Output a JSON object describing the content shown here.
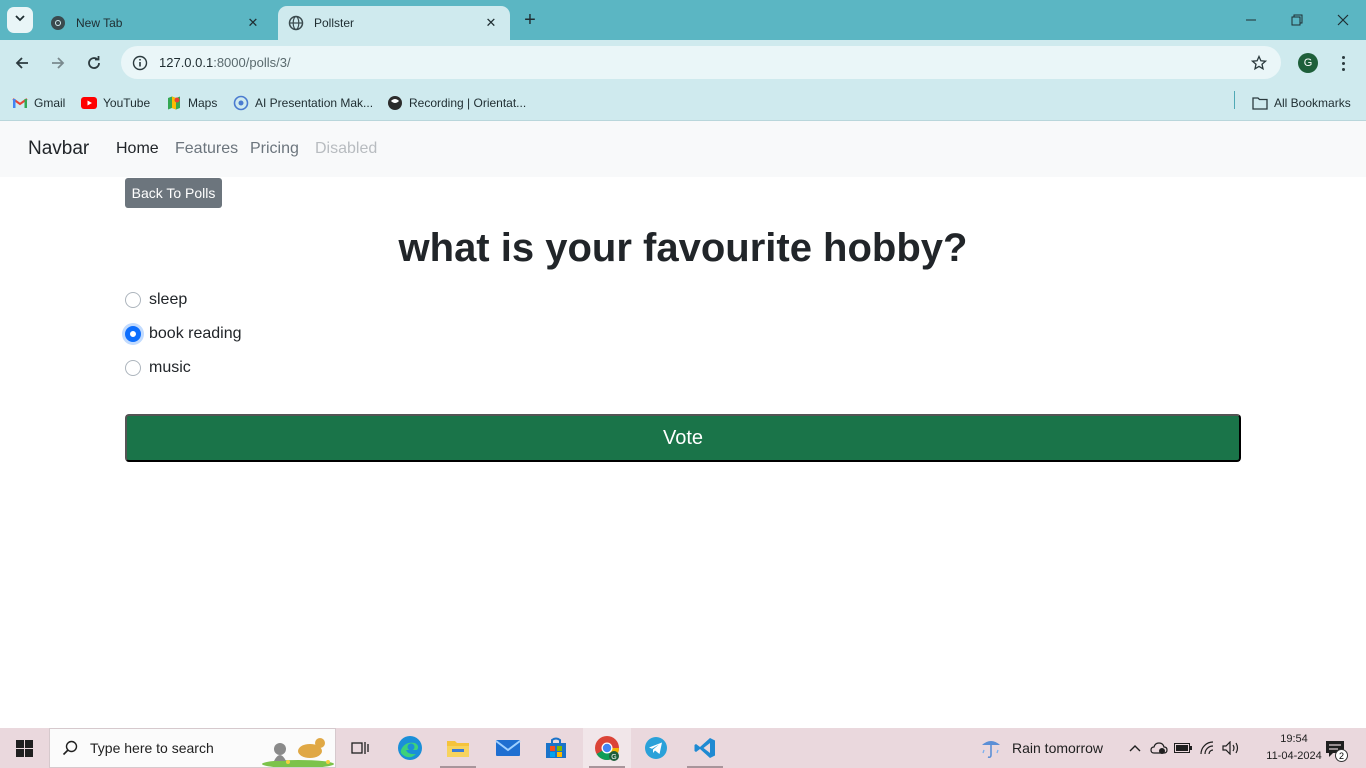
{
  "browser": {
    "tabs": [
      {
        "title": "New Tab",
        "favicon": "chrome-icon",
        "active": false
      },
      {
        "title": "Pollster",
        "favicon": "globe-icon",
        "active": true
      }
    ],
    "url_host": "127.0.0.1",
    "url_path": ":8000/polls/3/",
    "profile_initial": "G",
    "bookmarks": [
      {
        "label": "Gmail",
        "icon": "gmail-icon"
      },
      {
        "label": "YouTube",
        "icon": "youtube-icon"
      },
      {
        "label": "Maps",
        "icon": "maps-icon"
      },
      {
        "label": "AI Presentation Mak...",
        "icon": "ai-presentation-icon"
      },
      {
        "label": "Recording | Orientat...",
        "icon": "recording-icon"
      }
    ],
    "all_bookmarks_label": "All Bookmarks"
  },
  "navbar": {
    "brand": "Navbar",
    "links": [
      {
        "label": "Home",
        "state": "active"
      },
      {
        "label": "Features",
        "state": "normal"
      },
      {
        "label": "Pricing",
        "state": "normal"
      },
      {
        "label": "Disabled",
        "state": "disabled"
      }
    ]
  },
  "poll": {
    "back_label": "Back To Polls",
    "question": "what is your favourite hobby?",
    "choices": [
      {
        "label": "sleep",
        "checked": false
      },
      {
        "label": "book reading",
        "checked": true
      },
      {
        "label": "music",
        "checked": false
      }
    ],
    "vote_label": "Vote"
  },
  "taskbar": {
    "search_placeholder": "Type here to search",
    "weather": "Rain tomorrow",
    "time": "19:54",
    "date": "11-04-2024",
    "notification_count": "2"
  },
  "colors": {
    "tabstrip": "#5bb6c3",
    "toolbar": "#cfeaee",
    "vote_button": "#1a7449",
    "back_button": "#6c757d",
    "radio_checked": "#0d6efd"
  }
}
